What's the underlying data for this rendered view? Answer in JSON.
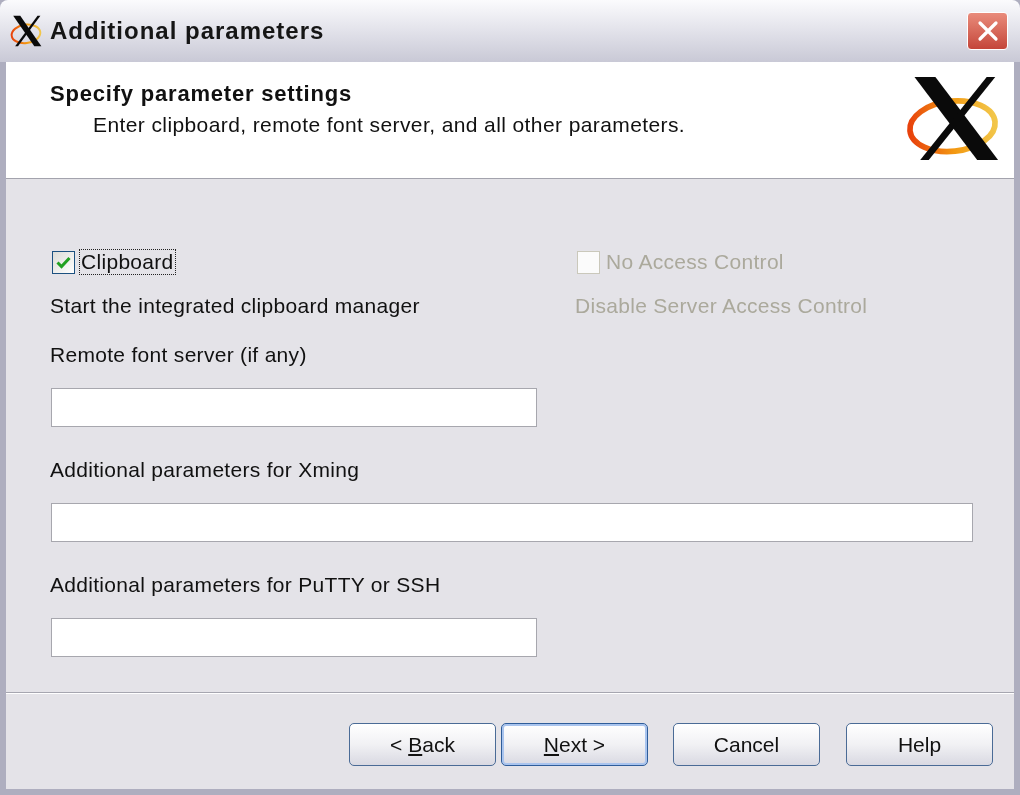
{
  "window": {
    "title": "Additional parameters"
  },
  "header": {
    "title": "Specify parameter settings",
    "subtitle": "Enter clipboard, remote font server, and all other parameters."
  },
  "options": [
    {
      "label": "Clipboard",
      "description": "Start the integrated clipboard manager",
      "checked": true,
      "disabled": false,
      "focused": true
    },
    {
      "label": "No Access Control",
      "description": "Disable Server Access Control",
      "checked": false,
      "disabled": true,
      "focused": false
    }
  ],
  "fields": [
    {
      "label": "Remote font server (if any)"
    },
    {
      "label": "Additional parameters for Xming"
    },
    {
      "label": "Additional parameters for PuTTY or SSH"
    }
  ],
  "buttons": [
    {
      "label": "< Back",
      "access_key_underlined": true,
      "default": false
    },
    {
      "label": "Next >",
      "access_key_underlined": true,
      "default": true
    },
    {
      "label": "Cancel",
      "access_key_underlined": false,
      "default": false
    },
    {
      "label": "Help",
      "access_key_underlined": false,
      "default": false
    }
  ]
}
